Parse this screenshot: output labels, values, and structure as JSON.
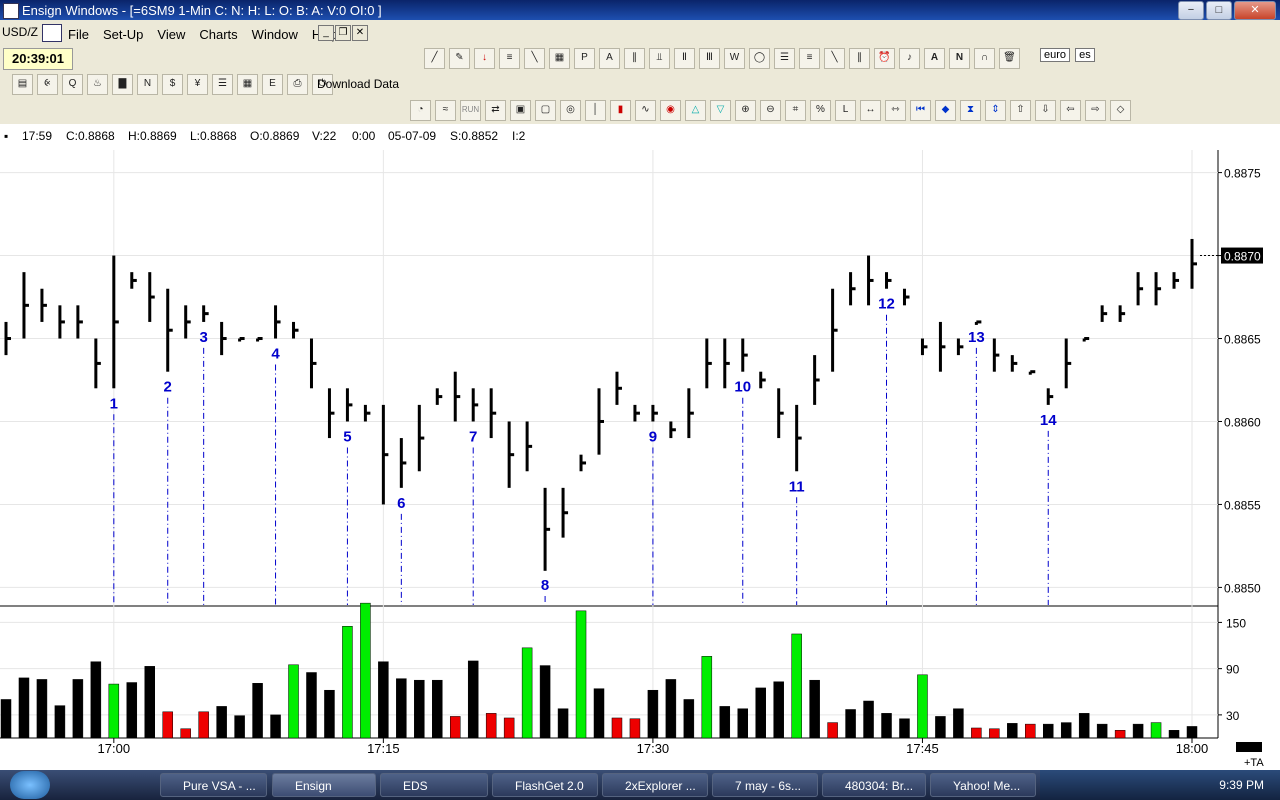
{
  "window": {
    "title": "Ensign Windows - [=6SM9 1-Min C: N: H: L: O: B: A: V:0 OI:0 ]"
  },
  "symbol": "USD/Z",
  "menu": [
    "File",
    "Set-Up",
    "View",
    "Charts",
    "Window",
    "Help"
  ],
  "clock": "20:39:01",
  "download_label": "Download Data",
  "run_label": "RUN",
  "tabs": [
    "euro",
    "es"
  ],
  "info": {
    "time": "17:59",
    "close": "C:0.8868",
    "high": "H:0.8869",
    "low": "L:0.8868",
    "open": "O:0.8869",
    "volume": "V:22",
    "zero": "0:00",
    "date": "05-07-09",
    "settle": "S:0.8852",
    "interval": "I:2"
  },
  "current_price_label": "0.8870",
  "ta_label": "+TA",
  "colors": {
    "up": "#00ee00",
    "down": "#ee0000",
    "neutral": "#000000",
    "annotation": "#0000cc"
  },
  "chart_data": [
    {
      "type": "bar",
      "ohlc_note": "price bars drawn as high-low lines",
      "y_ticks": [
        "0.8875",
        "0.8870",
        "0.8865",
        "0.8860",
        "0.8855",
        "0.8850"
      ],
      "ylim": [
        0.8849,
        0.8876
      ],
      "x_ticks": [
        "17:00",
        "17:15",
        "17:30",
        "17:45",
        "18:00"
      ],
      "bars": [
        [
          0.8866,
          0.8864
        ],
        [
          0.8869,
          0.8865
        ],
        [
          0.8868,
          0.8866
        ],
        [
          0.8867,
          0.8865
        ],
        [
          0.8867,
          0.8865
        ],
        [
          0.8865,
          0.8862
        ],
        [
          0.887,
          0.8862
        ],
        [
          0.8869,
          0.8868
        ],
        [
          0.8869,
          0.8866
        ],
        [
          0.8868,
          0.8863
        ],
        [
          0.8867,
          0.8865
        ],
        [
          0.8867,
          0.8866
        ],
        [
          0.8866,
          0.8864
        ],
        [
          0.8865,
          0.8865
        ],
        [
          0.8865,
          0.8865
        ],
        [
          0.8867,
          0.8865
        ],
        [
          0.8866,
          0.8865
        ],
        [
          0.8865,
          0.8862
        ],
        [
          0.8862,
          0.8859
        ],
        [
          0.8862,
          0.886
        ],
        [
          0.8861,
          0.886
        ],
        [
          0.8861,
          0.8855
        ],
        [
          0.8859,
          0.8856
        ],
        [
          0.8861,
          0.8857
        ],
        [
          0.8862,
          0.8861
        ],
        [
          0.8863,
          0.886
        ],
        [
          0.8862,
          0.886
        ],
        [
          0.8862,
          0.8859
        ],
        [
          0.886,
          0.8856
        ],
        [
          0.886,
          0.8857
        ],
        [
          0.8856,
          0.8851
        ],
        [
          0.8856,
          0.8853
        ],
        [
          0.8858,
          0.8857
        ],
        [
          0.8862,
          0.8858
        ],
        [
          0.8863,
          0.8861
        ],
        [
          0.8861,
          0.886
        ],
        [
          0.8861,
          0.886
        ],
        [
          0.886,
          0.8859
        ],
        [
          0.8862,
          0.8859
        ],
        [
          0.8865,
          0.8862
        ],
        [
          0.8865,
          0.8862
        ],
        [
          0.8865,
          0.8863
        ],
        [
          0.8863,
          0.8862
        ],
        [
          0.8862,
          0.8859
        ],
        [
          0.8861,
          0.8857
        ],
        [
          0.8864,
          0.8861
        ],
        [
          0.8868,
          0.8863
        ],
        [
          0.8869,
          0.8867
        ],
        [
          0.887,
          0.8867
        ],
        [
          0.8869,
          0.8868
        ],
        [
          0.8868,
          0.8867
        ],
        [
          0.8865,
          0.8864
        ],
        [
          0.8866,
          0.8863
        ],
        [
          0.8865,
          0.8864
        ],
        [
          0.8866,
          0.8866
        ],
        [
          0.8865,
          0.8863
        ],
        [
          0.8864,
          0.8863
        ],
        [
          0.8863,
          0.8863
        ],
        [
          0.8862,
          0.8861
        ],
        [
          0.8865,
          0.8862
        ],
        [
          0.8865,
          0.8865
        ],
        [
          0.8867,
          0.8866
        ],
        [
          0.8867,
          0.8866
        ],
        [
          0.8869,
          0.8867
        ],
        [
          0.8869,
          0.8867
        ],
        [
          0.8869,
          0.8868
        ],
        [
          0.8871,
          0.8868
        ]
      ],
      "annotations": [
        {
          "label": "1",
          "bar": 6
        },
        {
          "label": "2",
          "bar": 9
        },
        {
          "label": "3",
          "bar": 11
        },
        {
          "label": "4",
          "bar": 15
        },
        {
          "label": "5",
          "bar": 19
        },
        {
          "label": "6",
          "bar": 22
        },
        {
          "label": "7",
          "bar": 26
        },
        {
          "label": "8",
          "bar": 30
        },
        {
          "label": "9",
          "bar": 36
        },
        {
          "label": "10",
          "bar": 41
        },
        {
          "label": "11",
          "bar": 44
        },
        {
          "label": "12",
          "bar": 49
        },
        {
          "label": "13",
          "bar": 54
        },
        {
          "label": "14",
          "bar": 58
        }
      ]
    },
    {
      "type": "bar",
      "title": "",
      "y_ticks": [
        "150",
        "90",
        "30"
      ],
      "ylim": [
        0,
        170
      ],
      "values": [
        50,
        78,
        76,
        42,
        76,
        99,
        70,
        72,
        93,
        34,
        12,
        34,
        41,
        29,
        71,
        30,
        95,
        85,
        62,
        145,
        175,
        99,
        77,
        75,
        75,
        28,
        100,
        32,
        26,
        117,
        94,
        38,
        165,
        64,
        26,
        25,
        62,
        76,
        50,
        106,
        41,
        38,
        65,
        73,
        135,
        75,
        20,
        37,
        48,
        32,
        25,
        82,
        28,
        38,
        13,
        12,
        19,
        18,
        18,
        20,
        32,
        18,
        10,
        18,
        20,
        10,
        15
      ],
      "colors": [
        "n",
        "n",
        "n",
        "n",
        "n",
        "n",
        "u",
        "n",
        "n",
        "d",
        "d",
        "d",
        "n",
        "n",
        "n",
        "n",
        "u",
        "n",
        "n",
        "u",
        "u",
        "n",
        "n",
        "n",
        "n",
        "d",
        "n",
        "d",
        "d",
        "u",
        "n",
        "n",
        "u",
        "n",
        "d",
        "d",
        "n",
        "n",
        "n",
        "u",
        "n",
        "n",
        "n",
        "n",
        "u",
        "n",
        "d",
        "n",
        "n",
        "n",
        "n",
        "u",
        "n",
        "n",
        "d",
        "d",
        "n",
        "d",
        "n",
        "n",
        "n",
        "n",
        "d",
        "n",
        "u",
        "n",
        "n"
      ]
    }
  ]
}
